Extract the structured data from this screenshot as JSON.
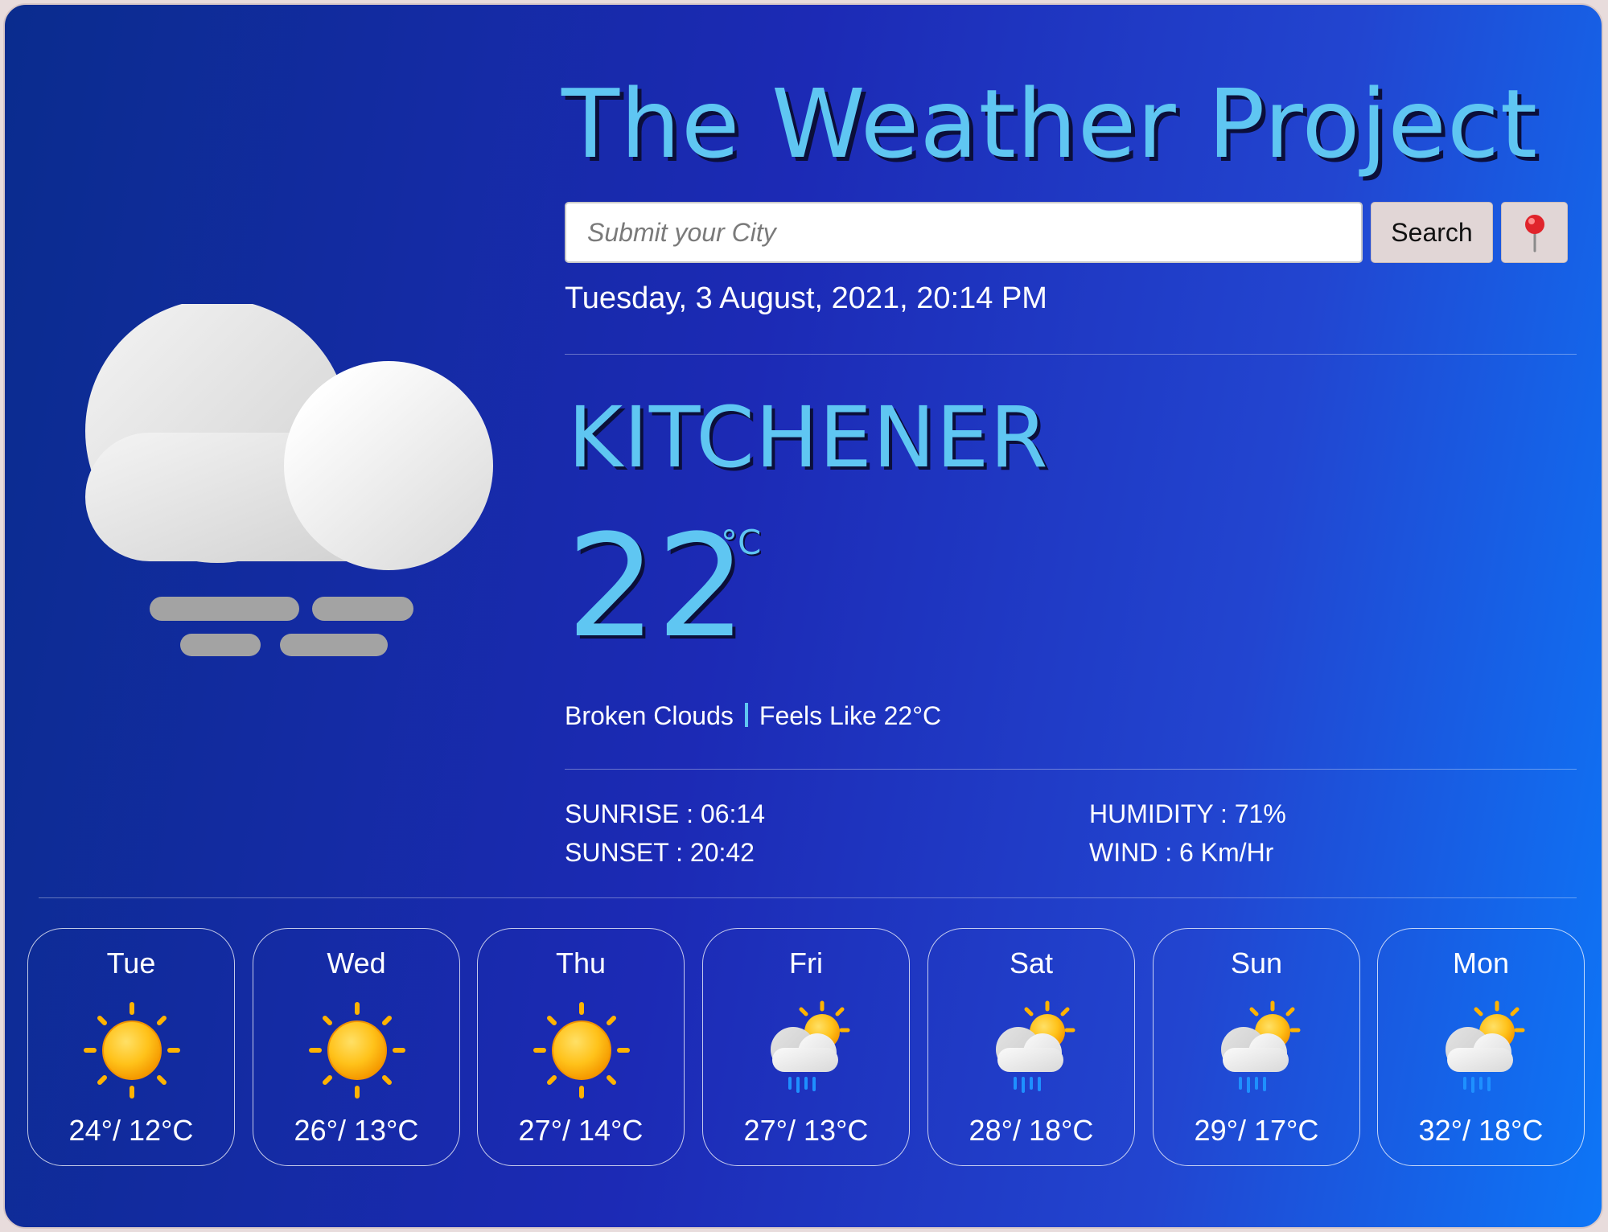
{
  "header": {
    "title": "The Weather Project"
  },
  "search": {
    "placeholder": "Submit your City",
    "value": "",
    "button_label": "Search",
    "location_button_icon": "round-pushpin-icon"
  },
  "current": {
    "datetime": "Tuesday, 3 August, 2021, 20:14 PM",
    "city": "KITCHENER",
    "temperature": "22",
    "unit": "°C",
    "description": "Broken Clouds",
    "feels_like": "Feels Like 22°C",
    "icon": "broken-clouds-mist-icon",
    "sunrise": "SUNRISE : 06:14",
    "sunset": "SUNSET : 20:42",
    "humidity": "HUMIDITY : 71%",
    "wind": "WIND : 6 Km/Hr"
  },
  "forecast": [
    {
      "day": "Tue",
      "temps": "24°/ 12°C",
      "icon": "sun-icon"
    },
    {
      "day": "Wed",
      "temps": "26°/ 13°C",
      "icon": "sun-icon"
    },
    {
      "day": "Thu",
      "temps": "27°/ 14°C",
      "icon": "sun-icon"
    },
    {
      "day": "Fri",
      "temps": "27°/ 13°C",
      "icon": "sun-cloud-rain-icon"
    },
    {
      "day": "Sat",
      "temps": "28°/ 18°C",
      "icon": "sun-cloud-rain-icon"
    },
    {
      "day": "Sun",
      "temps": "29°/ 17°C",
      "icon": "sun-cloud-rain-icon"
    },
    {
      "day": "Mon",
      "temps": "32°/ 18°C",
      "icon": "sun-cloud-rain-icon"
    }
  ],
  "colors": {
    "accent": "#5fc6f2",
    "background_start": "#0a2c8e",
    "background_end": "#0d76f7",
    "button": "#e1d6d6"
  }
}
